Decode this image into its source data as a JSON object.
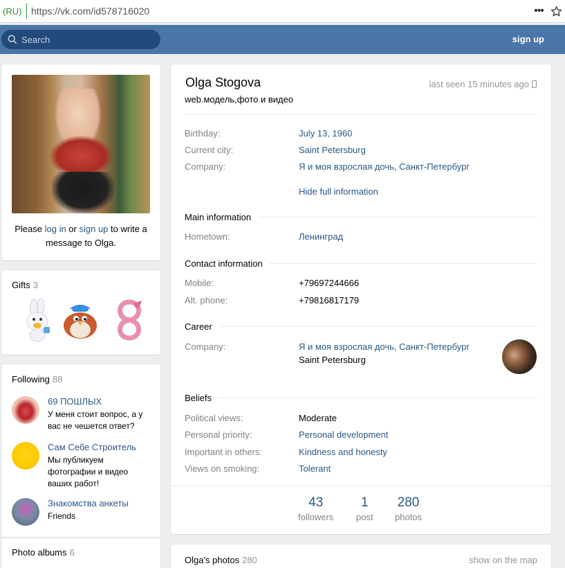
{
  "browser": {
    "lang": "(RU)",
    "url": "https://vk.com/id578716020",
    "menu_icon": "more-dots-icon",
    "bookmark_icon": "star-icon"
  },
  "header": {
    "search_placeholder": "Search",
    "sign_up": "sign up",
    "brand_color": "#4a76a8"
  },
  "photo_block": {
    "msg_prefix": "Please ",
    "log_in": "log in",
    "msg_or": " or ",
    "sign_up": "sign up",
    "msg_suffix": " to write a message to Olga."
  },
  "gifts": {
    "title": "Gifts",
    "count": "3",
    "items": [
      "bunny-gift-icon",
      "bird-gift-icon",
      "ribbon-eight-gift-icon"
    ]
  },
  "following": {
    "title": "Following",
    "count": "88",
    "items": [
      {
        "name": "69 ПОШЛЫХ",
        "desc": "У меня стоит вопрос, а у вас не чешется ответ?"
      },
      {
        "name": "Сам Себе Строитель",
        "desc": "Мы публикуем фотографии и видео ваших работ!"
      },
      {
        "name": "Знакомства анкеты",
        "desc": "Friends"
      }
    ]
  },
  "albums": {
    "title": "Photo albums",
    "count": "6"
  },
  "profile": {
    "name": "Olga Stogova",
    "status": "web.модель,фото и видео",
    "last_seen": "last seen 15 minutes ago",
    "birthday_label": "Birthday:",
    "birthday": "July 13, 1960",
    "city_label": "Current city:",
    "city": "Saint Petersburg",
    "company_label": "Company:",
    "company": "Я и моя взрослая дочь, Санкт-Петербург",
    "hide_info": "Hide full information"
  },
  "main_info": {
    "title": "Main information",
    "hometown_label": "Hometown:",
    "hometown": "Ленинград"
  },
  "contact": {
    "title": "Contact information",
    "mobile_label": "Mobile:",
    "mobile": "+79697244666",
    "alt_label": "Alt. phone:",
    "alt": "+79816817179"
  },
  "career": {
    "title": "Career",
    "company_label": "Company:",
    "company": "Я и моя взрослая дочь, Санкт-Петербург",
    "city": "Saint Petersburg"
  },
  "beliefs": {
    "title": "Beliefs",
    "political_label": "Political views:",
    "political": "Moderate",
    "priority_label": "Personal priority:",
    "priority": "Personal development",
    "important_label": "Important in others:",
    "important": "Kindness and honesty",
    "smoking_label": "Views on smoking:",
    "smoking": "Tolerant"
  },
  "counters": [
    {
      "num": "43",
      "label": "followers"
    },
    {
      "num": "1",
      "label": "post"
    },
    {
      "num": "280",
      "label": "photos"
    }
  ],
  "photos": {
    "title": "Olga's photos",
    "count": "280",
    "map": "show on the map"
  }
}
